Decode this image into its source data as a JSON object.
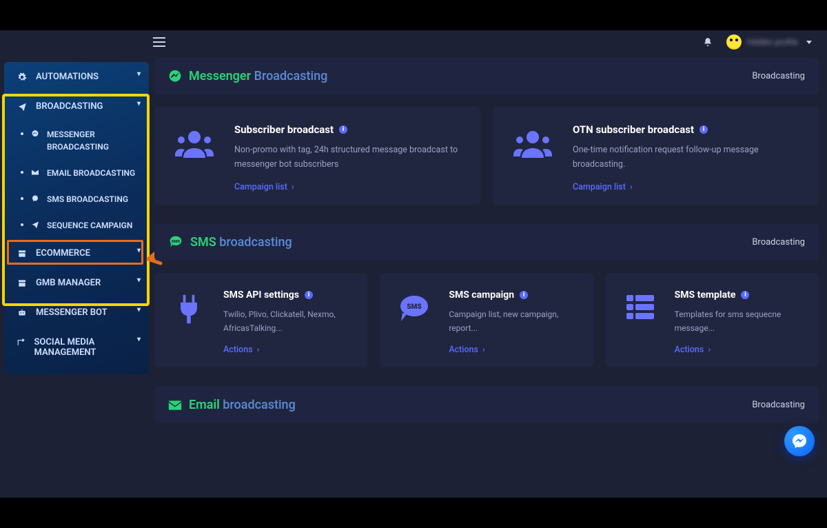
{
  "topbar": {
    "user_name": "Hidden profile",
    "bell": "Notifications"
  },
  "sidebar": {
    "automations": "AUTOMATIONS",
    "broadcasting": "BROADCASTING",
    "sub_messenger": "MESSENGER BROADCASTING",
    "sub_email": "EMAIL BROADCASTING",
    "sub_sms": "SMS BROADCASTING",
    "sub_sequence": "SEQUENCE CAMPAIGN",
    "ecommerce": "ECOMMERCE",
    "gmb": "GMB MANAGER",
    "messenger_bot": "MESSENGER BOT",
    "social": "SOCIAL MEDIA MANAGEMENT"
  },
  "sections": {
    "messenger": {
      "a": "Messenger",
      "b": "Broadcasting",
      "crumb": "Broadcasting"
    },
    "sms": {
      "a": "SMS",
      "b": "broadcasting",
      "crumb": "Broadcasting"
    },
    "email": {
      "a": "Email",
      "b": "broadcasting",
      "crumb": "Broadcasting"
    }
  },
  "cards": {
    "sub_broadcast": {
      "title": "Subscriber broadcast",
      "desc": "Non-promo with tag, 24h structured message broadcast to messenger bot subscribers",
      "action": "Campaign list"
    },
    "otn": {
      "title": "OTN subscriber broadcast",
      "desc": "One-time notification request follow-up message broadcasting.",
      "action": "Campaign list"
    },
    "sms_api": {
      "title": "SMS API settings",
      "desc": "Twilio, Plivo, Clickatell, Nexmo, AfricasTalking...",
      "action": "Actions"
    },
    "sms_campaign": {
      "title": "SMS campaign",
      "desc": "Campaign list, new campaign, report...",
      "action": "Actions"
    },
    "sms_template": {
      "title": "SMS template",
      "desc": "Templates for sms sequecne message...",
      "action": "Actions"
    }
  }
}
